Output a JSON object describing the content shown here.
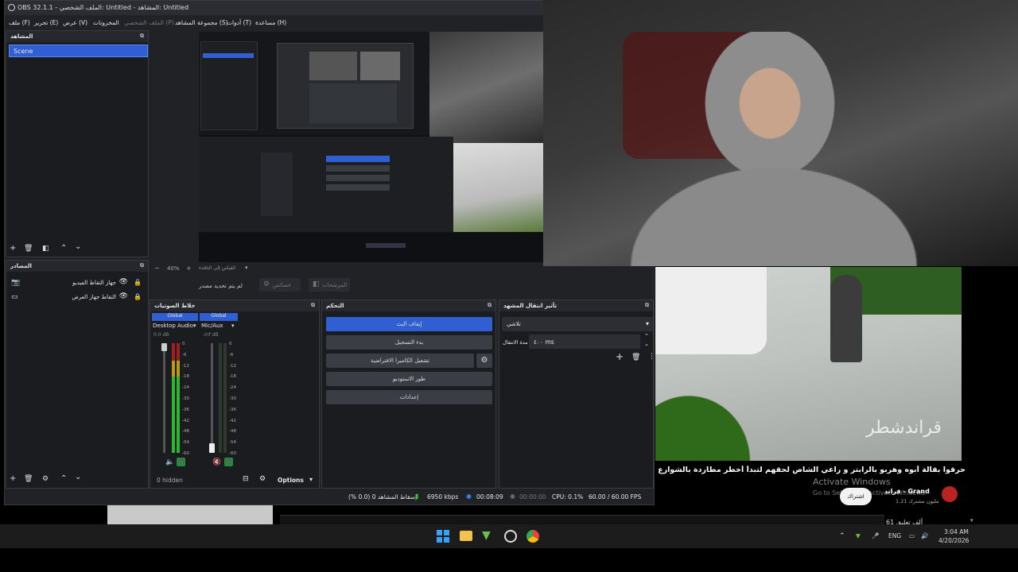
{
  "window": {
    "title": "OBS 32.1.1 - الملف الشخصي: Untitled - المشاهد: Untitled"
  },
  "menu": {
    "items": [
      "ملف (F)",
      "تحرير (E)",
      "عرض (V)",
      "المخزونات",
      "الملف الشخصي (P)",
      "مجموعة المشاهد (S)",
      "أدوات (T)",
      "مساعدة (H)"
    ]
  },
  "scenes": {
    "header": "المشاهد",
    "items": [
      "Scene"
    ]
  },
  "sources": {
    "header": "المصادر",
    "items": [
      {
        "label": "جهاز التقاط الفيديو",
        "icon": "camera-icon"
      },
      {
        "label": "التقاط جهاز العرض",
        "icon": "monitor-icon"
      }
    ]
  },
  "preview_toolbar": {
    "zoom": "40%",
    "hint": "القياس إلى النافذة"
  },
  "source_bar": {
    "no_source": "لم يتم تحديد مصدر",
    "properties": "خصائص",
    "filters": "المرشحات"
  },
  "mixer": {
    "header": "خلاط الصوتيات",
    "channels": [
      {
        "badge": "Global",
        "name": "Desktop Audio",
        "db": "0.0 dB",
        "level": 0.85
      },
      {
        "badge": "Global",
        "name": "Mic/Aux",
        "db": "-inf dB",
        "level": 0.0
      }
    ],
    "ticks": [
      "0",
      "-6",
      "-12",
      "-18",
      "-24",
      "-30",
      "-36",
      "-42",
      "-48",
      "-54",
      "-60"
    ],
    "hidden": "0 hidden",
    "options": "Options"
  },
  "controls": {
    "header": "التحكم",
    "buttons": [
      "إيقاف البث",
      "بدء التسجيل",
      "تشغيل الكاميرا الافتراضية",
      "طور الاستوديو",
      "إعدادات"
    ]
  },
  "transitions": {
    "header": "تأثير انتقال المشهد",
    "type": "تلاشي",
    "duration_label": "مدة الانتقال",
    "duration_value": "٤٠٠ ms"
  },
  "status": {
    "dropped": "إسقاط المشاهد 0 (0.0 %)",
    "bitrate": "6950 kbps",
    "stream_time": "00:08:09",
    "rec_time": "00:00:00",
    "cpu": "CPU: 0.1%",
    "fps": "60.00 / 60.00 FPS"
  },
  "youtube": {
    "title": "حرقوا بقالة أبوه وهربو بالرابتر و راعي الشاص لحقهم لتبدأ أخطر مطاردة بالشوارع | فيلم قران",
    "channel": "قراند - Grand",
    "subs": "1.21 مليون مشترك",
    "subscribe": "اشتراك",
    "watermark": "قراندشطر",
    "comments": "61 ألف تعليق"
  },
  "activation": {
    "line1": "Activate Windows",
    "line2": "Go to Settings to activate Windows."
  },
  "tray": {
    "lang": "ENG",
    "time": "3:04 AM",
    "date": "4/20/2026"
  }
}
